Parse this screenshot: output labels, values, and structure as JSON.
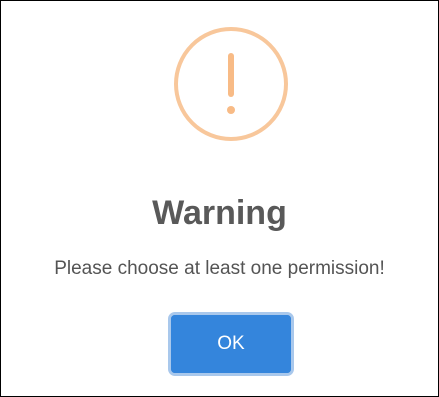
{
  "dialog": {
    "icon": "exclamation-circle-icon",
    "title": "Warning",
    "message": "Please choose at least one permission!",
    "ok_label": "OK"
  },
  "colors": {
    "icon_accent": "#f8bb86",
    "title_text": "#595959",
    "message_text": "#545454",
    "button_bg": "#3485dc",
    "button_focus_ring": "#a9c8ec",
    "button_text": "#ffffff"
  }
}
